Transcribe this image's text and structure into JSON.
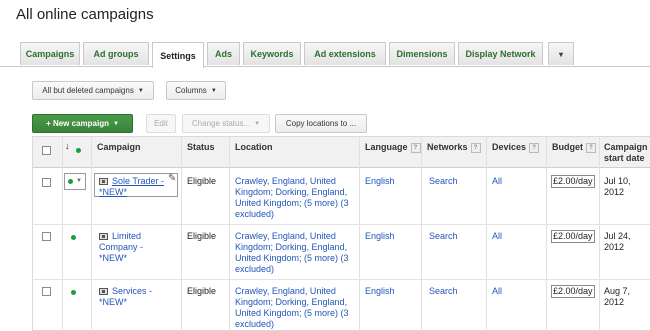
{
  "page": {
    "title": "All online campaigns"
  },
  "tabs": {
    "items": [
      {
        "label": "Campaigns"
      },
      {
        "label": "Ad groups"
      },
      {
        "label": "Settings"
      },
      {
        "label": "Ads"
      },
      {
        "label": "Keywords"
      },
      {
        "label": "Ad extensions"
      },
      {
        "label": "Dimensions"
      },
      {
        "label": "Display Network"
      },
      {
        "label": "▾"
      }
    ],
    "active": "Settings"
  },
  "filters": {
    "campaign_filter": "All but deleted campaigns",
    "columns": "Columns"
  },
  "toolbar": {
    "new_campaign": "+ New campaign",
    "edit": "Edit",
    "change_status": "Change status...",
    "copy_locations": "Copy locations to ..."
  },
  "table": {
    "headers": {
      "campaign": "Campaign",
      "status": "Status",
      "location": "Location",
      "language": "Language",
      "networks": "Networks",
      "devices": "Devices",
      "budget": "Budget",
      "start_date": "Campaign start date"
    },
    "rows": [
      {
        "name": "Sole Trader - *NEW*",
        "status": "Eligible",
        "location": "Crawley, England, United Kingdom; Dorking, England, United Kingdom; (5 more) (3 excluded)",
        "language": "English",
        "networks": "Search",
        "devices": "All",
        "budget": "£2.00/day",
        "start_date": "Jul 10, 2012"
      },
      {
        "name": "Limited Company - *NEW*",
        "status": "Eligible",
        "location": "Crawley, England, United Kingdom; Dorking, England, United Kingdom; (5 more) (3 excluded)",
        "language": "English",
        "networks": "Search",
        "devices": "All",
        "budget": "£2.00/day",
        "start_date": "Jul 24, 2012"
      },
      {
        "name": "Services - *NEW*",
        "status": "Eligible",
        "location": "Crawley, England, United Kingdom; Dorking, England, United Kingdom; (5 more) (3 excluded)",
        "language": "English",
        "networks": "Search",
        "devices": "All",
        "budget": "£2.00/day",
        "start_date": "Aug 7, 2012"
      }
    ]
  },
  "colors": {
    "accent_green": "#3b843b",
    "link_blue": "#2255bb",
    "status_dot": "#1a9e3a"
  }
}
